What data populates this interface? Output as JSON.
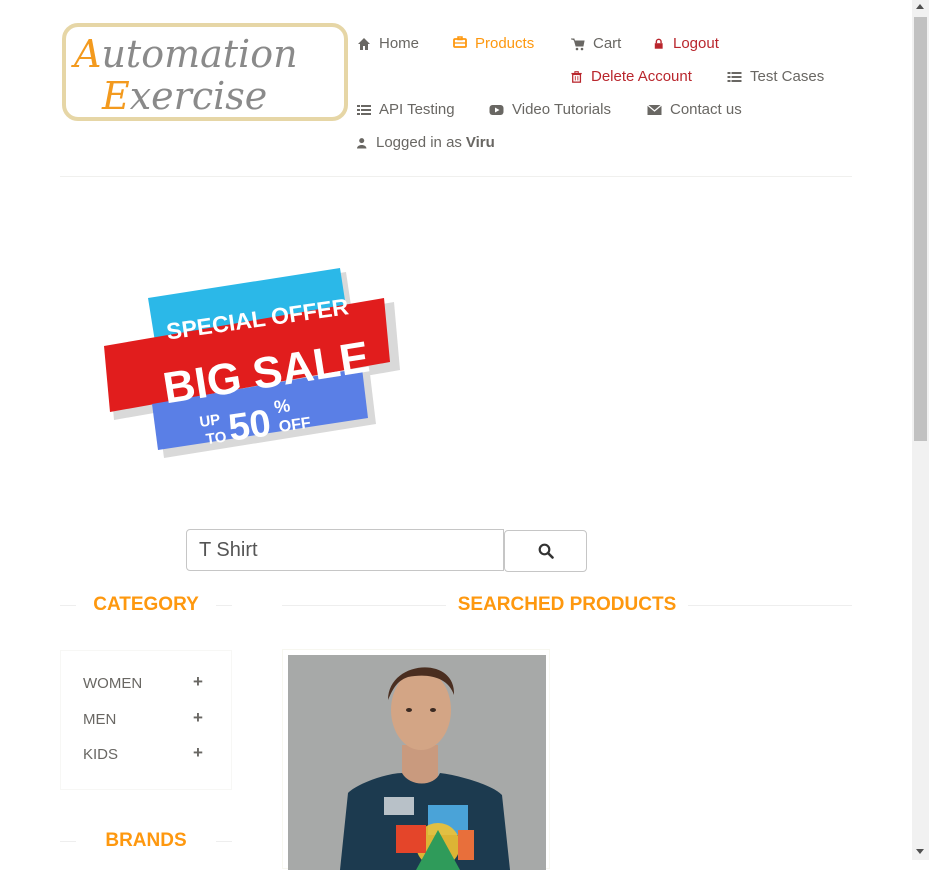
{
  "logo": {
    "line1": "Automation",
    "line2": "Exercise"
  },
  "nav": {
    "home": "Home",
    "products": "Products",
    "cart": "Cart",
    "logout": "Logout",
    "delete_account": "Delete Account",
    "test_cases": "Test Cases",
    "api_testing": "API Testing",
    "video_tutorials": "Video Tutorials",
    "contact_us": "Contact us",
    "logged_in_prefix": "Logged in as",
    "username": "Viru"
  },
  "banner": {
    "line1": "SPECIAL OFFER",
    "line2": "BIG SALE",
    "up": "UP",
    "to": "TO",
    "amount": "50",
    "percent": "%",
    "off": "OFF"
  },
  "search": {
    "value": "T Shirt",
    "icon": "search-icon"
  },
  "sections": {
    "category": "Category",
    "searched_products": "Searched Products",
    "brands": "Brands"
  },
  "categories": [
    {
      "label": "WOMEN",
      "toggle": "+"
    },
    {
      "label": "MEN",
      "toggle": "+"
    },
    {
      "label": "KIDS",
      "toggle": "+"
    }
  ],
  "colors": {
    "accent": "#fe980f",
    "danger": "#b9262d",
    "text": "#696763"
  }
}
